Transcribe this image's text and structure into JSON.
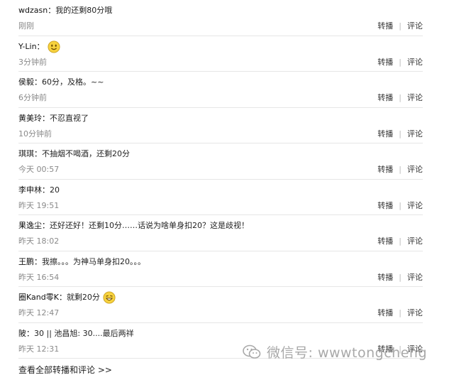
{
  "comments": [
    {
      "user": "wdzasn",
      "sep": "：",
      "text": "我的还剩80分哦",
      "time": "刚刚",
      "emoji": ""
    },
    {
      "user": "Y-Lin",
      "sep": "：",
      "text": "",
      "time": "3分钟前",
      "emoji": "smile-emoji-icon"
    },
    {
      "user": "侯毅",
      "sep": "：",
      "text": "60分，及格。~~",
      "time": "6分钟前",
      "emoji": ""
    },
    {
      "user": "黄美玲",
      "sep": "：",
      "text": "不忍直视了",
      "time": "10分钟前",
      "emoji": ""
    },
    {
      "user": "琪琪",
      "sep": "：",
      "text": "不抽烟不喝酒，还剩20分",
      "time": "今天 00:57",
      "emoji": ""
    },
    {
      "user": "李申林",
      "sep": "：",
      "text": "20",
      "time": "昨天 19:51",
      "emoji": ""
    },
    {
      "user": "果逸尘",
      "sep": "：",
      "text": "还好还好！还剩10分……话说为啥单身扣20？这是歧视！",
      "time": "昨天 18:02",
      "emoji": ""
    },
    {
      "user": "王鹏",
      "sep": "：",
      "text": "我擦。。。为神马单身扣20。。。",
      "time": "昨天 16:54",
      "emoji": ""
    },
    {
      "user": "圈Kand零K",
      "sep": "：",
      "text": "就剩20分",
      "time": "昨天 12:47",
      "emoji": "grin-emoji-icon"
    },
    {
      "user": "陂",
      "sep": "：",
      "text": "30 || 池昌旭: 30....最后两祥",
      "time": "昨天 12:31",
      "emoji": ""
    }
  ],
  "actions": {
    "forward": "转播",
    "comment": "评论",
    "divider": "|"
  },
  "more_link": "查看全部转播和评论 >>",
  "watermark": {
    "text": "微信号: wwwtongcheng"
  },
  "colors": {
    "time": "#8a8a8a",
    "divider": "#e6e6e6",
    "emoji": "#f7d23e"
  }
}
